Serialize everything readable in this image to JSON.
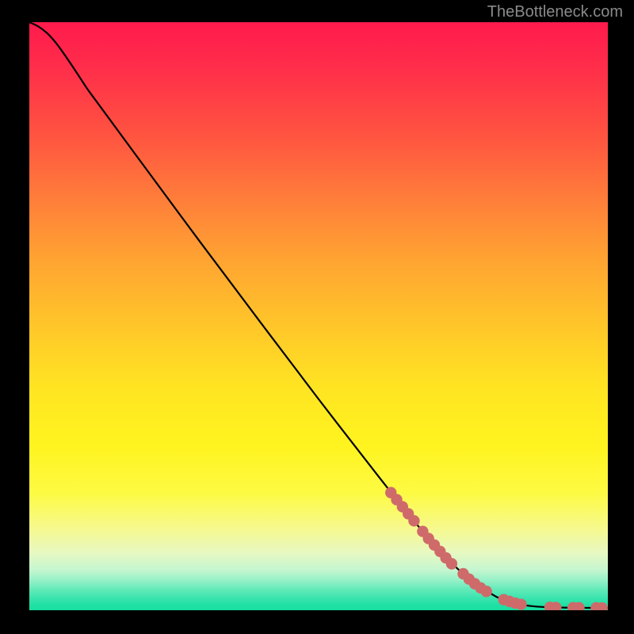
{
  "attribution": "TheBottleneck.com",
  "colors": {
    "marker": "#cf6a6a",
    "curve": "#000000",
    "gradient_top": "#ff1a4d",
    "gradient_bottom": "#18dfa0"
  },
  "chart_data": {
    "type": "line",
    "title": "",
    "xlabel": "",
    "ylabel": "",
    "xlim": [
      0,
      100
    ],
    "ylim": [
      0,
      100
    ],
    "grid": false,
    "legend": false,
    "series": [
      {
        "name": "curve",
        "x": [
          0.0,
          1.5,
          3.0,
          4.5,
          6.0,
          8.0,
          10.0,
          12.0,
          20.0,
          30.0,
          40.0,
          50.0,
          60.0,
          65.0,
          70.0,
          75.0,
          80.0,
          82.0,
          84.0,
          86.0,
          88.0,
          90.0,
          92.0,
          94.0,
          96.0,
          98.0,
          100.0
        ],
        "values": [
          100.0,
          99.3,
          98.2,
          96.6,
          94.6,
          91.7,
          88.7,
          86.0,
          75.3,
          62.0,
          48.9,
          35.9,
          23.2,
          17.0,
          11.1,
          6.2,
          2.7,
          1.8,
          1.2,
          0.8,
          0.6,
          0.5,
          0.45,
          0.42,
          0.41,
          0.4,
          0.4
        ]
      }
    ],
    "markers": [
      {
        "x": 62.5,
        "y": 20.0
      },
      {
        "x": 63.5,
        "y": 18.8
      },
      {
        "x": 64.5,
        "y": 17.6
      },
      {
        "x": 65.5,
        "y": 16.4
      },
      {
        "x": 66.5,
        "y": 15.2
      },
      {
        "x": 68.0,
        "y": 13.4
      },
      {
        "x": 69.0,
        "y": 12.2
      },
      {
        "x": 70.0,
        "y": 11.1
      },
      {
        "x": 71.0,
        "y": 10.0
      },
      {
        "x": 72.0,
        "y": 8.9
      },
      {
        "x": 73.0,
        "y": 7.9
      },
      {
        "x": 75.0,
        "y": 6.2
      },
      {
        "x": 76.0,
        "y": 5.3
      },
      {
        "x": 77.0,
        "y": 4.5
      },
      {
        "x": 78.0,
        "y": 3.8
      },
      {
        "x": 79.0,
        "y": 3.2
      },
      {
        "x": 82.0,
        "y": 1.8
      },
      {
        "x": 83.0,
        "y": 1.5
      },
      {
        "x": 84.0,
        "y": 1.2
      },
      {
        "x": 85.0,
        "y": 1.0
      },
      {
        "x": 90.0,
        "y": 0.5
      },
      {
        "x": 91.0,
        "y": 0.47
      },
      {
        "x": 94.0,
        "y": 0.43
      },
      {
        "x": 95.0,
        "y": 0.42
      },
      {
        "x": 98.0,
        "y": 0.41
      },
      {
        "x": 99.0,
        "y": 0.4
      }
    ]
  }
}
